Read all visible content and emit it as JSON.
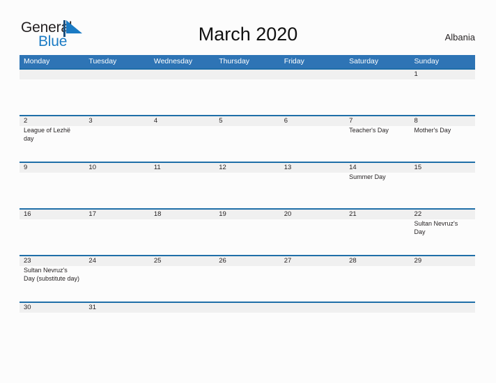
{
  "brand": {
    "word_one": "General",
    "word_two": "Blue",
    "flag_icon": "blue-triangle-flag-icon",
    "dark_color": "#231f20",
    "accent_color": "#1b7bc4"
  },
  "header": {
    "title": "March 2020",
    "country": "Albania"
  },
  "theme": {
    "header_blue": "#2e74b5",
    "row_rule_blue": "#1f6fa8",
    "date_band_gray": "#f0f0f0",
    "page_background": "#fcfcfc",
    "text_color": "#231f20"
  },
  "calendar": {
    "month": "March",
    "year": "2020",
    "weekday_headers": [
      "Monday",
      "Tuesday",
      "Wednesday",
      "Thursday",
      "Friday",
      "Saturday",
      "Sunday"
    ],
    "weeks": [
      [
        {
          "date": "",
          "event": ""
        },
        {
          "date": "",
          "event": ""
        },
        {
          "date": "",
          "event": ""
        },
        {
          "date": "",
          "event": ""
        },
        {
          "date": "",
          "event": ""
        },
        {
          "date": "",
          "event": ""
        },
        {
          "date": "1",
          "event": ""
        }
      ],
      [
        {
          "date": "2",
          "event": "League of Lezhë day"
        },
        {
          "date": "3",
          "event": ""
        },
        {
          "date": "4",
          "event": ""
        },
        {
          "date": "5",
          "event": ""
        },
        {
          "date": "6",
          "event": ""
        },
        {
          "date": "7",
          "event": "Teacher's Day"
        },
        {
          "date": "8",
          "event": "Mother's Day"
        }
      ],
      [
        {
          "date": "9",
          "event": ""
        },
        {
          "date": "10",
          "event": ""
        },
        {
          "date": "11",
          "event": ""
        },
        {
          "date": "12",
          "event": ""
        },
        {
          "date": "13",
          "event": ""
        },
        {
          "date": "14",
          "event": "Summer Day"
        },
        {
          "date": "15",
          "event": ""
        }
      ],
      [
        {
          "date": "16",
          "event": ""
        },
        {
          "date": "17",
          "event": ""
        },
        {
          "date": "18",
          "event": ""
        },
        {
          "date": "19",
          "event": ""
        },
        {
          "date": "20",
          "event": ""
        },
        {
          "date": "21",
          "event": ""
        },
        {
          "date": "22",
          "event": "Sultan Nevruz's Day"
        }
      ],
      [
        {
          "date": "23",
          "event": "Sultan Nevruz's Day (substitute day)"
        },
        {
          "date": "24",
          "event": ""
        },
        {
          "date": "25",
          "event": ""
        },
        {
          "date": "26",
          "event": ""
        },
        {
          "date": "27",
          "event": ""
        },
        {
          "date": "28",
          "event": ""
        },
        {
          "date": "29",
          "event": ""
        }
      ],
      [
        {
          "date": "30",
          "event": ""
        },
        {
          "date": "31",
          "event": ""
        },
        {
          "date": "",
          "event": ""
        },
        {
          "date": "",
          "event": ""
        },
        {
          "date": "",
          "event": ""
        },
        {
          "date": "",
          "event": ""
        },
        {
          "date": "",
          "event": ""
        }
      ]
    ]
  }
}
